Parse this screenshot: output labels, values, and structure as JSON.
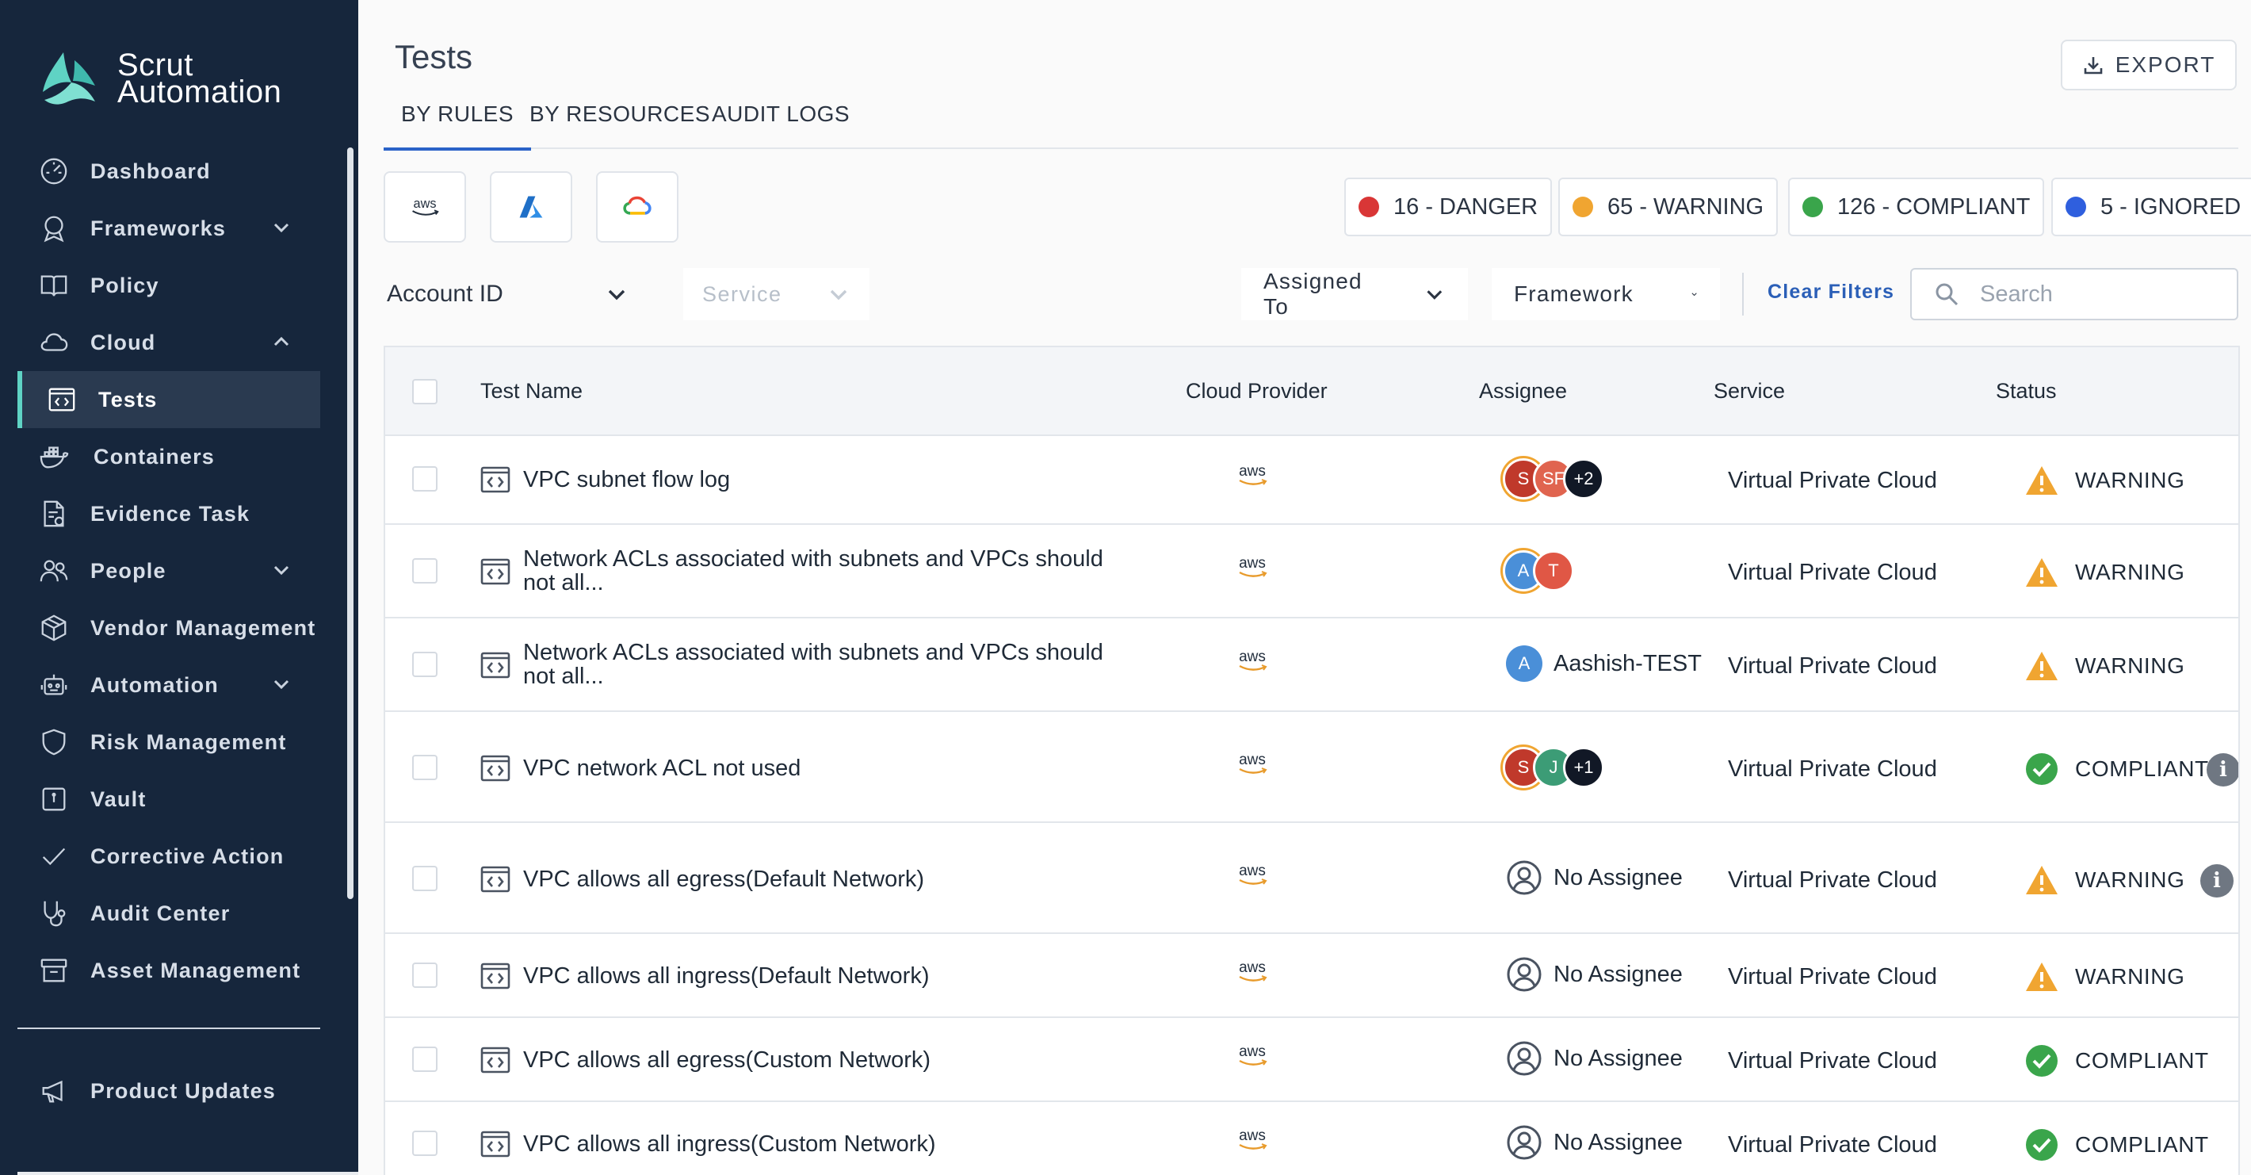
{
  "brand": {
    "line1": "Scrut",
    "line2": "Automation"
  },
  "sidebar": {
    "items": [
      {
        "label": "Dashboard",
        "icon": "dashboard-icon"
      },
      {
        "label": "Frameworks",
        "icon": "award-icon",
        "expand": "chevron-down"
      },
      {
        "label": "Policy",
        "icon": "book-icon"
      },
      {
        "label": "Cloud",
        "icon": "cloud-icon",
        "expand": "chevron-up"
      },
      {
        "label": "Tests",
        "icon": "code-window-icon",
        "active": true
      },
      {
        "label": "Containers",
        "icon": "docker-icon"
      },
      {
        "label": "Evidence Task",
        "icon": "document-check-icon"
      },
      {
        "label": "People",
        "icon": "people-icon",
        "expand": "chevron-down"
      },
      {
        "label": "Vendor Management",
        "icon": "package-icon"
      },
      {
        "label": "Automation",
        "icon": "robot-icon",
        "expand": "chevron-down"
      },
      {
        "label": "Risk Management",
        "icon": "shield-icon"
      },
      {
        "label": "Vault",
        "icon": "vault-icon"
      },
      {
        "label": "Corrective Action",
        "icon": "check-icon"
      },
      {
        "label": "Audit Center",
        "icon": "stethoscope-icon"
      },
      {
        "label": "Asset Management",
        "icon": "archive-icon"
      }
    ],
    "product_updates": "Product Updates"
  },
  "header": {
    "title": "Tests",
    "export_label": "EXPORT"
  },
  "tabs": [
    {
      "label": "BY RULES",
      "active": true
    },
    {
      "label": "BY RESOURCES"
    },
    {
      "label": "AUDIT LOGS"
    }
  ],
  "providers": [
    "aws-icon",
    "azure-icon",
    "gcp-icon"
  ],
  "summary": [
    {
      "label": "16 - DANGER",
      "color": "#d93636"
    },
    {
      "label": "65 - WARNING",
      "color": "#f0a531"
    },
    {
      "label": "126 - COMPLIANT",
      "color": "#3aa54b"
    },
    {
      "label": "5 - IGNORED",
      "color": "#2f5fde"
    }
  ],
  "filters": {
    "account_id": "Account ID",
    "service": "Service",
    "assigned_to": "Assigned To",
    "framework": "Framework",
    "clear": "Clear Filters",
    "search_placeholder": "Search"
  },
  "table": {
    "columns": [
      "Test Name",
      "Cloud Provider",
      "Assignee",
      "Service",
      "Status"
    ],
    "rows": [
      {
        "name": "VPC subnet flow log",
        "provider": "aws",
        "assignees": [
          {
            "initial": "S",
            "color": "#c0392b"
          },
          {
            "initial": "SF",
            "color": "#e0644f"
          },
          {
            "initial": "+2",
            "color": "#111826"
          }
        ],
        "service": "Virtual Private Cloud",
        "status": "WARNING"
      },
      {
        "name": "Network ACLs associated with subnets and VPCs should not all...",
        "provider": "aws",
        "assignees": [
          {
            "initial": "A",
            "color": "#4a8fd8"
          },
          {
            "initial": "T",
            "color": "#e05745"
          }
        ],
        "service": "Virtual Private Cloud",
        "status": "WARNING"
      },
      {
        "name": "Network ACLs associated with subnets and VPCs should not all...",
        "provider": "aws",
        "assignee_single": {
          "initial": "A",
          "name": "Aashish-TEST",
          "color": "#4a8fd8"
        },
        "service": "Virtual Private Cloud",
        "status": "WARNING"
      },
      {
        "name": "VPC network ACL not used",
        "provider": "aws",
        "assignees": [
          {
            "initial": "S",
            "color": "#c0392b"
          },
          {
            "initial": "J",
            "color": "#3c9c76"
          },
          {
            "initial": "+1",
            "color": "#111826"
          }
        ],
        "service": "Virtual Private Cloud",
        "status": "COMPLIANT",
        "info": "i"
      },
      {
        "name": "VPC allows all egress(Default Network)",
        "provider": "aws",
        "no_assignee": "No Assignee",
        "service": "Virtual Private Cloud",
        "status": "WARNING",
        "info": "i"
      },
      {
        "name": "VPC allows all ingress(Default Network)",
        "provider": "aws",
        "no_assignee": "No Assignee",
        "service": "Virtual Private Cloud",
        "status": "WARNING"
      },
      {
        "name": "VPC allows all egress(Custom Network)",
        "provider": "aws",
        "no_assignee": "No Assignee",
        "service": "Virtual Private Cloud",
        "status": "COMPLIANT"
      },
      {
        "name": "VPC allows all ingress(Custom Network)",
        "provider": "aws",
        "no_assignee": "No Assignee",
        "service": "Virtual Private Cloud",
        "status": "COMPLIANT"
      }
    ]
  }
}
